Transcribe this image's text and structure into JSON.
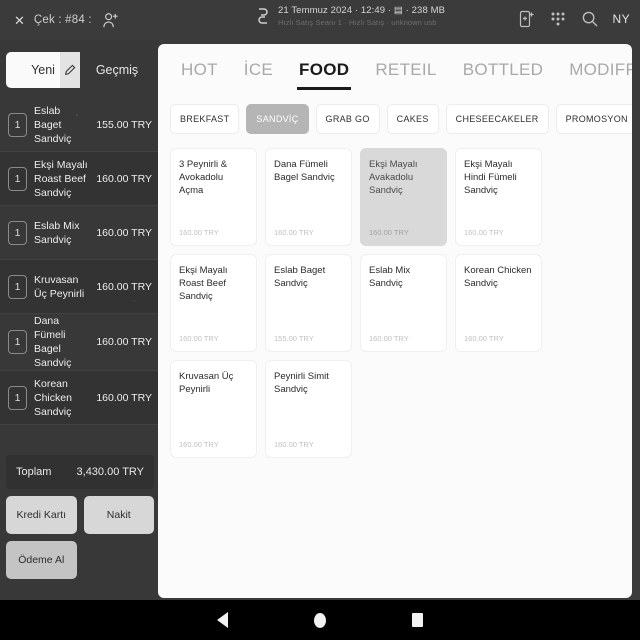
{
  "statusbar": {
    "close_icon": "close-icon",
    "check_label": "Çek : #84 :",
    "add_person_icon": "add-person-icon",
    "sync_icon": "sync-icon",
    "meta_primary": "21 Temmuz 2024 · 12:49 · ▤ · 238 MB",
    "meta_secondary": "Hızlı Satış Seanı 1 · Hızlı Satış · unknown usb",
    "add_device_icon": "add-device-icon",
    "keypad_icon": "keypad-grid-icon",
    "search_icon": "search-icon",
    "user_initials": "NY"
  },
  "cart": {
    "tab_new": "Yeni",
    "tab_new_icon": "pencil-icon",
    "tab_history": "Geçmiş",
    "items": [
      {
        "qty": "1",
        "name": "Eslab Baget Sandviç",
        "price": "155.00 TRY"
      },
      {
        "qty": "1",
        "name": "Ekşi Mayalı Roast Beef Sandviç",
        "price": "160.00 TRY"
      },
      {
        "qty": "1",
        "name": "Eslab Mix Sandviç",
        "price": "160.00 TRY"
      },
      {
        "qty": "1",
        "name": "Kruvasan Üç Peynirli",
        "price": "160.00 TRY"
      },
      {
        "qty": "1",
        "name": "Dana Fümeli Bagel Sandviç",
        "price": "160.00 TRY"
      },
      {
        "qty": "1",
        "name": "Korean Chicken Sandviç",
        "price": "160.00 TRY"
      }
    ],
    "total_label": "Toplam",
    "total_value": "3,430.00 TRY",
    "pay_credit": "Kredi Kartı",
    "pay_cash": "Nakit",
    "pay_take": "Ödeme Al"
  },
  "catalog": {
    "tabs": [
      {
        "label": "HOT",
        "active": false
      },
      {
        "label": "İCE",
        "active": false
      },
      {
        "label": "FOOD",
        "active": true
      },
      {
        "label": "RETEIL",
        "active": false
      },
      {
        "label": "BOTTLED",
        "active": false
      },
      {
        "label": "MODIFFRES",
        "active": false
      }
    ],
    "chips": [
      {
        "label": "BREKFAST",
        "selected": false
      },
      {
        "label": "SANDVİÇ",
        "selected": true
      },
      {
        "label": "GRAB GO",
        "selected": false
      },
      {
        "label": "CAKES",
        "selected": false
      },
      {
        "label": "CHESEECAKELER",
        "selected": false
      },
      {
        "label": "PROMOSYON",
        "selected": false
      }
    ],
    "products": [
      {
        "name": "3 Peynirli & Avokadolu Açma",
        "price": "160.00 TRY",
        "selected": false
      },
      {
        "name": "Dana Fümeli Bagel Sandviç",
        "price": "160.00 TRY",
        "selected": false
      },
      {
        "name": "Ekşi Mayalı Avakadolu Sandviç",
        "price": "160.00 TRY",
        "selected": true
      },
      {
        "name": "Ekşi Mayalı Hindi Fümeli Sandviç",
        "price": "160.00 TRY",
        "selected": false
      },
      {
        "name": "Ekşi Mayalı Roast Beef Sandviç",
        "price": "160.00 TRY",
        "selected": false
      },
      {
        "name": "Eslab Baget Sandviç",
        "price": "155.00 TRY",
        "selected": false
      },
      {
        "name": "Eslab Mix Sandviç",
        "price": "160.00 TRY",
        "selected": false
      },
      {
        "name": "Korean Chicken Sandviç",
        "price": "160.00 TRY",
        "selected": false
      },
      {
        "name": "Kruvasan Üç Peynirli",
        "price": "160.00 TRY",
        "selected": false
      },
      {
        "name": "Peynirli Simit Sandviç",
        "price": "160.00 TRY",
        "selected": false
      }
    ]
  },
  "navbar": {
    "back_icon": "back-triangle-icon",
    "home_icon": "home-circle-icon",
    "recents_icon": "recents-square-icon"
  },
  "colors": {
    "app_bg": "#3b3b3b",
    "panel_bg": "#fbfbfb",
    "accent": "#1b1b1b",
    "chip_selected": "#b5b5b5"
  }
}
